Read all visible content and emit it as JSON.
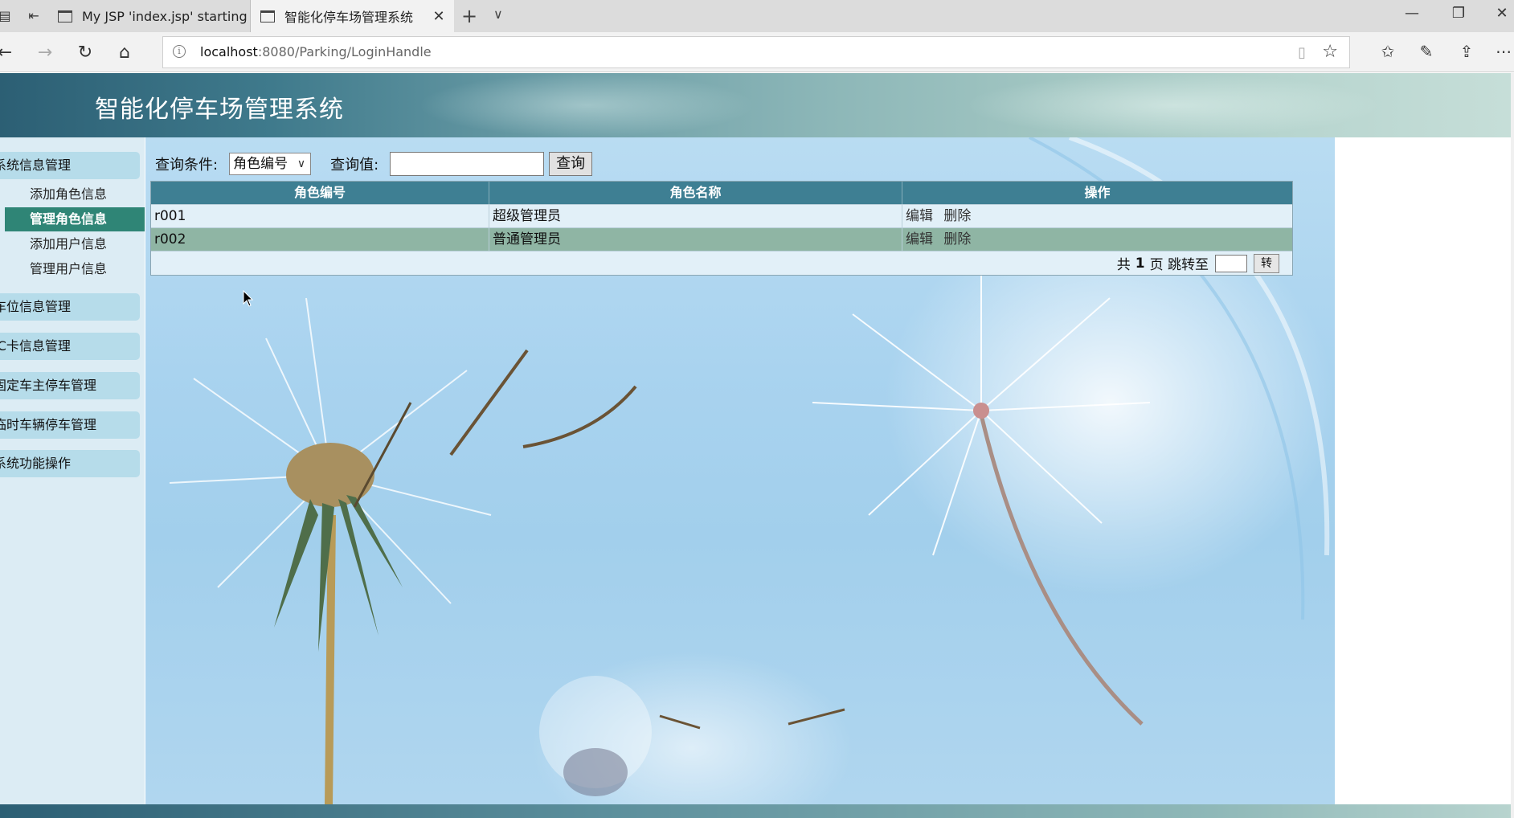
{
  "browser": {
    "tabs": [
      {
        "title": "My JSP 'index.jsp' starting p",
        "active": false
      },
      {
        "title": "智能化停车场管理系统",
        "active": true
      }
    ],
    "url_host": "localhost",
    "url_path": ":8080/Parking/LoginHandle"
  },
  "header": {
    "title": "智能化停车场管理系统"
  },
  "sidebar": {
    "groups": [
      {
        "label": "系统信息管理"
      },
      {
        "label": "车位信息管理"
      },
      {
        "label": "IC卡信息管理"
      },
      {
        "label": "固定车主停车管理"
      },
      {
        "label": "临时车辆停车管理"
      },
      {
        "label": "系统功能操作"
      }
    ],
    "sub_items": [
      {
        "label": "添加角色信息",
        "active": false
      },
      {
        "label": "管理角色信息",
        "active": true
      },
      {
        "label": "添加用户信息",
        "active": false
      },
      {
        "label": "管理用户信息",
        "active": false
      }
    ]
  },
  "query": {
    "condition_label": "查询条件:",
    "condition_selected": "角色编号",
    "value_label": "查询值:",
    "value": "",
    "button_label": "查询"
  },
  "table": {
    "headers": [
      "角色编号",
      "角色名称",
      "操作"
    ],
    "rows": [
      {
        "id": "r001",
        "name": "超级管理员",
        "edit": "编辑",
        "delete": "删除"
      },
      {
        "id": "r002",
        "name": "普通管理员",
        "edit": "编辑",
        "delete": "删除"
      }
    ]
  },
  "pager": {
    "prefix": "共",
    "total_pages": "1",
    "suffix": "页 跳转至",
    "jump_button": "转"
  },
  "colors": {
    "banner": "#3f7a8c",
    "menu_group_bg": "#b6dcea",
    "active_item_bg": "#2f8576",
    "table_header_bg": "#3e7f93",
    "row_even_bg": "#8fb5a4"
  }
}
